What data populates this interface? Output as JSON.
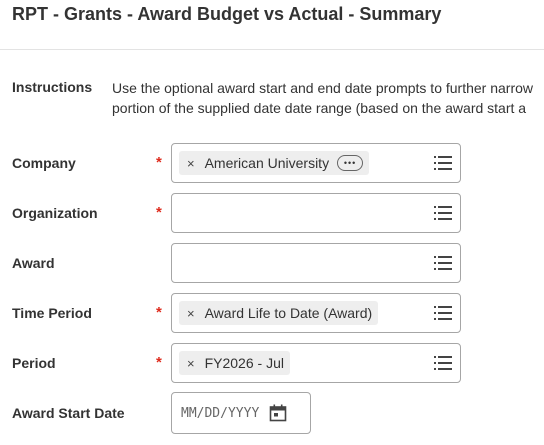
{
  "page": {
    "title": "RPT - Grants - Award Budget vs Actual - Summary"
  },
  "instructions": {
    "label": "Instructions",
    "line1": "Use the optional award start and end date prompts to further narrow",
    "line2": "portion of the supplied date date range (based on the award start a"
  },
  "fields": {
    "company": {
      "label": "Company",
      "required": "*",
      "value": "American University",
      "more_glyph": "•••"
    },
    "organization": {
      "label": "Organization",
      "required": "*"
    },
    "award": {
      "label": "Award"
    },
    "time_period": {
      "label": "Time Period",
      "required": "*",
      "value": "Award Life to Date (Award)"
    },
    "period": {
      "label": "Period",
      "required": "*",
      "value": "FY2026 - Jul"
    },
    "award_start_date": {
      "label": "Award Start Date",
      "placeholder": "MM/DD/YYYY"
    }
  },
  "icons": {
    "remove": "×",
    "prompt": "list-icon",
    "calendar": "calendar-icon"
  },
  "colors": {
    "required": "#de2a1c",
    "pill_bg": "#eeeeee",
    "border": "#a6a6a6"
  }
}
